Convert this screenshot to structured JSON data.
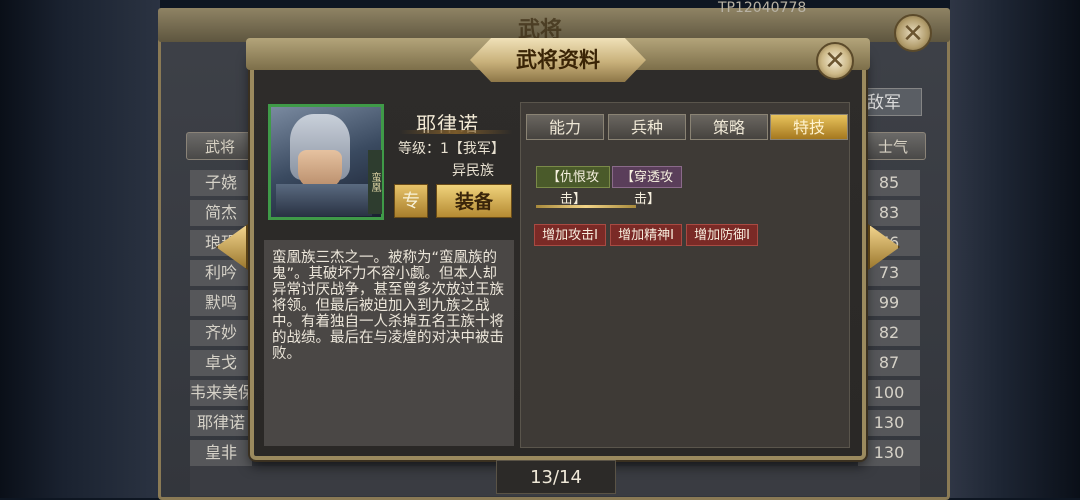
{
  "background": {
    "title": "武将",
    "top_id": "TP12040778",
    "tab_army": "敌军",
    "column_general": "武将",
    "column_morale": "士气",
    "rows": [
      {
        "name": "子娆",
        "morale": "85"
      },
      {
        "name": "简杰",
        "morale": "83"
      },
      {
        "name": "琅玥",
        "morale": "76"
      },
      {
        "name": "利吟",
        "morale": "73"
      },
      {
        "name": "默鸣",
        "morale": "99"
      },
      {
        "name": "齐妙",
        "morale": "82"
      },
      {
        "name": "卓戈",
        "morale": "87"
      },
      {
        "name": "韦来美保",
        "morale": "100"
      },
      {
        "name": "耶律诺",
        "morale": "130"
      },
      {
        "name": "皇非",
        "morale": "130"
      }
    ]
  },
  "dialog": {
    "title": "武将资料",
    "close_icon": "close-icon",
    "general": {
      "name": "耶律诺",
      "level_label": "等级：",
      "level_value": "1【我军】",
      "tribe": "异民族",
      "badge": "蛮凰",
      "btn_special": "专",
      "btn_equip": "装备"
    },
    "description": "蛮凰族三杰之一。被称为“蛮凰族的鬼”。其破坏力不容小觑。但本人却异常讨厌战争，甚至曾多次放过王族将领。但最后被迫加入到九族之战中。有着独自一人杀掉五名王族十将的战绩。最后在与凌煌的对决中被击败。",
    "tabs": [
      "能力",
      "兵种",
      "策略",
      "特技"
    ],
    "active_tab": 3,
    "skills": [
      "【仇恨攻击】",
      "【穿透攻击】"
    ],
    "bonuses": [
      "增加攻击Ⅰ",
      "增加精神Ⅰ",
      "增加防御Ⅰ"
    ]
  },
  "pager": "13/14",
  "colors": {
    "gold": "#c8b07a",
    "active_tab": "#e8c35c",
    "skill_green": "#4a5a2a",
    "skill_purple": "#5a3e5a",
    "bonus_red": "#7a2a26"
  }
}
